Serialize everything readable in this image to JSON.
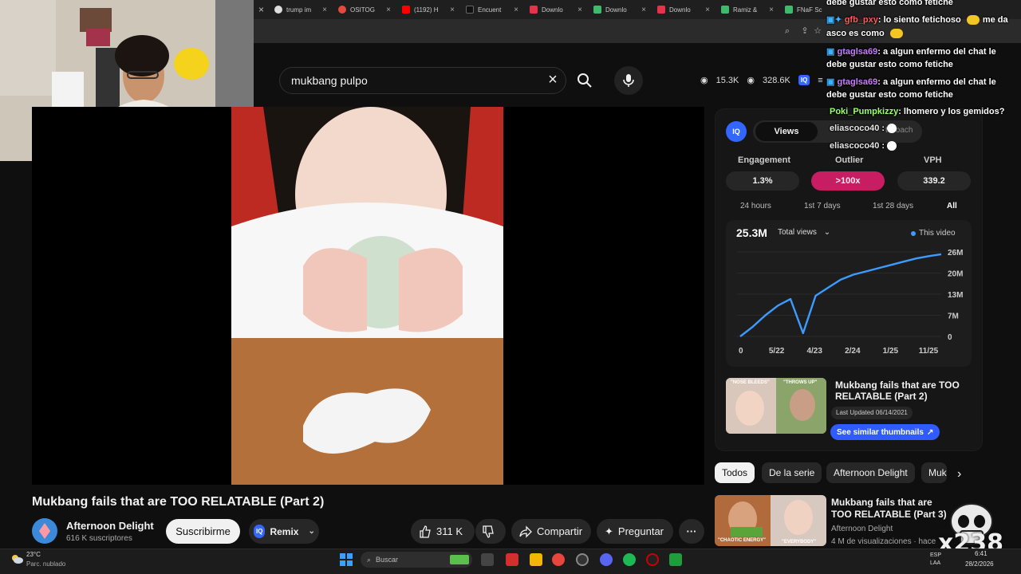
{
  "browser": {
    "tabs": [
      {
        "label": "trump im",
        "color": "#dddddd"
      },
      {
        "label": "OSITOG",
        "color": "#e64a3c"
      },
      {
        "label": "(1192) H",
        "color": "#ff0000"
      },
      {
        "label": "Encuent",
        "color": "#222222"
      },
      {
        "label": "Downlo",
        "color": "#e6334a"
      },
      {
        "label": "Downlo",
        "color": "#3dbb6b"
      },
      {
        "label": "Downlo",
        "color": "#e6334a"
      },
      {
        "label": "Ramiz &",
        "color": "#3dbb6b"
      },
      {
        "label": "FNaF Sc",
        "color": "#3dbb6b"
      }
    ]
  },
  "header": {
    "search_query": "mukbang pulpo",
    "stat_subs": "15.3K",
    "stat_views": "328.6K",
    "iq_label": "IQ"
  },
  "video": {
    "title": "Mukbang fails that are TOO RELATABLE (Part 2)",
    "channel_name": "Afternoon Delight",
    "channel_subs": "616 K suscriptores",
    "subscribe_label": "Suscribirme",
    "remix_label": "Remix",
    "like_count": "311 K",
    "share_label": "Compartir",
    "ask_label": "Preguntar"
  },
  "vidiq": {
    "logo": "IQ",
    "views_tab": "Views",
    "coach_tab": "t Coach",
    "metrics": [
      {
        "label": "Engagement",
        "value": "1.3%"
      },
      {
        "label": "Outlier",
        "value": ">100x"
      },
      {
        "label": "VPH",
        "value": "339.2"
      }
    ],
    "ranges": [
      "24 hours",
      "1st 7 days",
      "1st 28 days",
      "All"
    ],
    "total_value": "25.3M",
    "total_select": "Total views",
    "legend": "This video",
    "card_title": "Mukbang fails that are TOO RELATABLE (Part 2)",
    "card_date": "Last Updated 06/14/2021",
    "similar_label": "See similar thumbnails",
    "thumb_caption_left": "\"NOSE BLEEDS\"",
    "thumb_caption_right": "\"THROWS UP\""
  },
  "chart_data": {
    "type": "line",
    "x_tick_labels": [
      "0",
      "5/22",
      "4/23",
      "2/24",
      "1/25",
      "11/25"
    ],
    "y_tick_labels": [
      "26M",
      "20M",
      "13M",
      "7M",
      "0"
    ],
    "ylim": [
      0,
      26000000
    ],
    "series": [
      {
        "name": "This video",
        "values": [
          0,
          3000000,
          6500000,
          9500000,
          11500000,
          1000000,
          12500000,
          15000000,
          17500000,
          19000000,
          20000000,
          21000000,
          22000000,
          23000000,
          24000000,
          24700000,
          25300000
        ]
      }
    ]
  },
  "chips": [
    "Todos",
    "De la serie",
    "Afternoon Delight",
    "Muk"
  ],
  "related": {
    "title": "Mukbang fails that are TOO RELATABLE (Part 3)",
    "channel": "Afternoon Delight",
    "meta": "4 M de visualizaciones · hace",
    "thumb_caption_left": "\"CHAOTIC ENERGY\"",
    "thumb_caption_right": "\"EVERYBODY\""
  },
  "chat": [
    {
      "user": "",
      "text": "debe gustar esto como fetiche",
      "cls": "grey"
    },
    {
      "user": "gfb_pxy",
      "text": ": lo siento fetichoso",
      "cls": "red",
      "tail": "me da"
    },
    {
      "user": "",
      "text": "asco es como",
      "cls": "grey"
    },
    {
      "user": "gtaglsa69",
      "text": ": a algun enfermo del chat le",
      "cls": ""
    },
    {
      "user": "",
      "text": "debe gustar esto como fetiche",
      "cls": "grey"
    },
    {
      "user": "gtaglsa69",
      "text": ": a algun enfermo del chat le",
      "cls": ""
    },
    {
      "user": "",
      "text": "debe gustar esto como fetiche",
      "cls": "grey"
    },
    {
      "user": "Poki_Pumpkizzy",
      "text": ": lhomero y los gemidos?",
      "cls": "green"
    },
    {
      "user": "eliascoco40",
      "text": " :",
      "cls": "grey"
    },
    {
      "user": "eliascoco40",
      "text": " :",
      "cls": "grey"
    }
  ],
  "overlay": {
    "count": "x238"
  },
  "taskbar": {
    "temp": "23°C",
    "weather": "Parc. nublado",
    "search_placeholder": "Buscar",
    "lang": "ESP LAA",
    "time": "6:41",
    "date": "28/2/2026"
  }
}
